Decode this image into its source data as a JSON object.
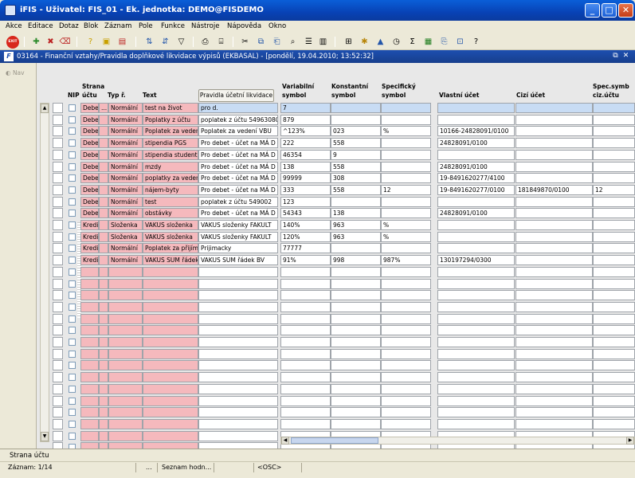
{
  "window": {
    "title": "iFIS - Uživatel: FIS_01 - Ek. jednotka: DEMO@FISDEMO"
  },
  "menu": [
    "Akce",
    "Editace",
    "Dotaz",
    "Blok",
    "Záznam",
    "Pole",
    "Funkce",
    "Nástroje",
    "Nápověda",
    "Okno"
  ],
  "toolbar": {
    "exit_label": "EXIT"
  },
  "document": {
    "title": "03164 - Finanční vztahy/Pravidla doplňkové likvidace výpisů (EKBASAL) - [pondělí, 19.04.2010; 13:52:32]"
  },
  "nav": {
    "label": "Nav"
  },
  "grid": {
    "headers": {
      "nip": "NIP",
      "strana_1": "Strana",
      "strana_2": "účtu",
      "typ": "Typ ř.",
      "text": "Text",
      "pravidla": "Pravidla účetní likvidace",
      "vs_1": "Variabilní",
      "vs_2": "symbol",
      "ks_1": "Konstantní",
      "ks_2": "symbol",
      "ss_1": "Specifický",
      "ss_2": "symbol",
      "vlastni": "Vlastní účet",
      "cizi": "Cizí účet",
      "spec_1": "Spec.symb",
      "spec_2": "ciz.účtu"
    },
    "rows": [
      {
        "mark": "",
        "strana": "Debet",
        "dots": "...",
        "typ": "Normální",
        "text": "test na život",
        "pravidla": "pro d.",
        "vs": "7",
        "ks": "",
        "ss": "",
        "vlastni": "",
        "cizi": "",
        "spec": ""
      },
      {
        "mark": "",
        "strana": "Debet",
        "dots": "",
        "typ": "Normální",
        "text": "Poplatky z účtu",
        "pravidla": "poplatek z účtu 54963080",
        "vs": "879",
        "ks": "",
        "ss": "",
        "vlastni": "",
        "cizi": "",
        "spec": ""
      },
      {
        "mark": "",
        "strana": "Debet",
        "dots": "",
        "typ": "Normální",
        "text": "Poplatek za vedení",
        "pravidla": "Poplatek za vedení VBU",
        "vs": "^123%",
        "ks": "023",
        "ss": "%",
        "vlastni": "10166-24828091/0100",
        "cizi": "",
        "spec": ""
      },
      {
        "mark": "*",
        "strana": "Debet",
        "dots": "",
        "typ": "Normální",
        "text": "stipendia PGS",
        "pravidla": "Pro debet - účet na MÁ D",
        "vs": "222",
        "ks": "558",
        "ss": "",
        "vlastni": "24828091/0100",
        "cizi": "",
        "spec": ""
      },
      {
        "mark": "",
        "strana": "Debet",
        "dots": "",
        "typ": "Normální",
        "text": "stipendia studentů",
        "pravidla": "Pro debet - účet na MÁ D",
        "vs": "46354",
        "ks": "9",
        "ss": "",
        "vlastni": "",
        "cizi": "",
        "spec": ""
      },
      {
        "mark": "",
        "strana": "Debet",
        "dots": "",
        "typ": "Normální",
        "text": "mzdy",
        "pravidla": "Pro debet - účet na MÁ D",
        "vs": "138",
        "ks": "558",
        "ss": "",
        "vlastni": "24828091/0100",
        "cizi": "",
        "spec": ""
      },
      {
        "mark": "",
        "strana": "Debet",
        "dots": "",
        "typ": "Normální",
        "text": "poplatky za vedení",
        "pravidla": "Pro debet - účet na MÁ D",
        "vs": "99999",
        "ks": "308",
        "ss": "",
        "vlastni": "19-8491620277/4100",
        "cizi": "",
        "spec": ""
      },
      {
        "mark": "*",
        "strana": "Debet",
        "dots": "",
        "typ": "Normální",
        "text": "nájem-byty",
        "pravidla": "Pro debet - účet na MÁ D",
        "vs": "333",
        "ks": "558",
        "ss": "12",
        "vlastni": "19-8491620277/0100",
        "cizi": "181849870/0100",
        "spec": "12"
      },
      {
        "mark": "",
        "strana": "Debet",
        "dots": "",
        "typ": "Normální",
        "text": "test",
        "pravidla": "poplatek z účtu 549002",
        "vs": "123",
        "ks": "",
        "ss": "",
        "vlastni": "",
        "cizi": "",
        "spec": ""
      },
      {
        "mark": "*",
        "strana": "Debet",
        "dots": "",
        "typ": "Normální",
        "text": "obstávky",
        "pravidla": "Pro debet - účet na MÁ D",
        "vs": "54343",
        "ks": "138",
        "ss": "",
        "vlastni": "24828091/0100",
        "cizi": "",
        "spec": ""
      },
      {
        "mark": "",
        "strana": "Kredit",
        "dots": "",
        "typ": "Složenka",
        "text": "VAKUS složenka",
        "pravidla": "VAKUS složenky FAKULT",
        "vs": "140%",
        "ks": "963",
        "ss": "%",
        "vlastni": "",
        "cizi": "",
        "spec": ""
      },
      {
        "mark": "",
        "strana": "Kredit",
        "dots": "",
        "typ": "Složenka",
        "text": "VAKUS složenka",
        "pravidla": "VAKUS složenky FAKULT",
        "vs": "120%",
        "ks": "963",
        "ss": "%",
        "vlastni": "",
        "cizi": "",
        "spec": ""
      },
      {
        "mark": "",
        "strana": "Kredit",
        "dots": "",
        "typ": "Normální",
        "text": "Poplatek za přijímací",
        "pravidla": "Prijimacky",
        "vs": "77777",
        "ks": "",
        "ss": "",
        "vlastni": "",
        "cizi": "",
        "spec": ""
      },
      {
        "mark": "",
        "strana": "Kredit",
        "dots": "",
        "typ": "Normální",
        "text": "VAKUS SUM řádek",
        "pravidla": "VAKUS SUM řádek BV",
        "vs": "91%",
        "ks": "998",
        "ss": "987%",
        "vlastni": "130197294/0300",
        "cizi": "",
        "spec": ""
      }
    ],
    "empty_rows": 16
  },
  "status": {
    "field": "Strana účtu",
    "record": "Záznam: 1/14",
    "dots": "...",
    "list": "Seznam hodn...",
    "osc": "<OSC>"
  }
}
